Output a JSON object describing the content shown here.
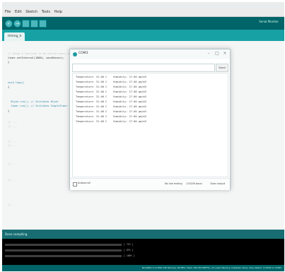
{
  "ide": {
    "menu": [
      "File",
      "Edit",
      "Sketch",
      "Tools",
      "Help"
    ],
    "toolbar_right": "Serial Monitor",
    "tab": "timing_h",
    "code_lines": [
      "// Setup a function to be called every second",
      "timer.setInterval(1000L, sendSensor);",
      "}",
      "",
      "void loop()",
      "{",
      "  Blynk.run(); // Initiates Blynk",
      "  timer.run(); // Initiates SimpleTimer",
      "}",
      "",
      "// ...",
      "// ...",
      "",
      "// ...",
      "// ...",
      "",
      "// ...",
      "// ...",
      "",
      "// ..."
    ],
    "status": "Done compiling.",
    "console_tags": [
      "[ 72% ]",
      "[ 83% ]",
      "[ 100% ]"
    ],
    "bottom_status": "NodeMCU 1.0 (ESP-12E Module), 80 MHz, Flash, 4M (3M SPIFFS), v2 Lower Memory, Disabled, None, Only Sketch, 115200 on COM3"
  },
  "serial": {
    "title": "COM3",
    "send_label": "Send",
    "rows": [
      "Temperature: 31.00 C    Humidity: 27.00 gm/m3",
      "Temperature: 31.00 C    Humidity: 27.00 gm/m3",
      "Temperature: 31.00 C    Humidity: 27.00 gm/m3",
      "Temperature: 31.00 C    Humidity: 27.00 gm/m3",
      "Temperature: 31.00 C    Humidity: 27.00 gm/m3",
      "Temperature: 31.00 C    Humidity: 27.00 gm/m3",
      "Temperature: 31.00 C    Humidity: 27.00 gm/m3",
      "Temperature: 31.00 C    Humidity: 27.00 gm/m3",
      "Temperature: 31.00 C    Humidity: 27.00 gm/m3",
      "Temperature: 31.00 C    Humidity: 27.00 gm/m3"
    ],
    "autoscroll_label": "Autoscroll",
    "line_ending": "No line ending",
    "baud": "115200 baud",
    "clear_label": "Clear output"
  },
  "colors": {
    "toolbar": "#006468",
    "tabbar": "#17a1a5",
    "console": "#000000"
  }
}
